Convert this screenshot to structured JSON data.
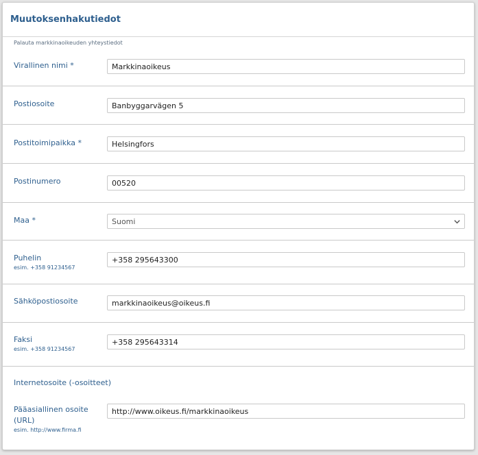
{
  "form": {
    "title": "Muutoksenhakutiedot",
    "subtitle": "Palauta markkinaoikeuden yhteystiedot",
    "fields": {
      "official_name": {
        "label": "Virallinen nimi *",
        "value": "Markkinaoikeus"
      },
      "street_address": {
        "label": "Postiosoite",
        "value": "Banbyggarvägen 5"
      },
      "city": {
        "label": "Postitoimipaikka *",
        "value": "Helsingfors"
      },
      "postal_code": {
        "label": "Postinumero",
        "value": "00520"
      },
      "country": {
        "label": "Maa *",
        "value": "Suomi"
      },
      "phone": {
        "label": "Puhelin",
        "hint": "esim. +358 91234567",
        "value": "+358 295643300"
      },
      "email": {
        "label": "Sähköpostiosoite",
        "value": "markkinaoikeus@oikeus.fi"
      },
      "fax": {
        "label": "Faksi",
        "hint": "esim. +358 91234567",
        "value": "+358 295643314"
      },
      "website_section": {
        "label": "Internetosoite (-osoitteet)"
      },
      "main_url": {
        "label_line1": "Pääasiallinen osoite",
        "label_line2": "(URL)",
        "hint": "esim. http://www.firma.fi",
        "value": "http://www.oikeus.fi/markkinaoikeus"
      }
    }
  },
  "colors": {
    "label": "#2e5f8e",
    "separator": "#c9c9c9",
    "background": "#e6e6e6"
  },
  "icons": {
    "select": "chevron-down-icon"
  }
}
